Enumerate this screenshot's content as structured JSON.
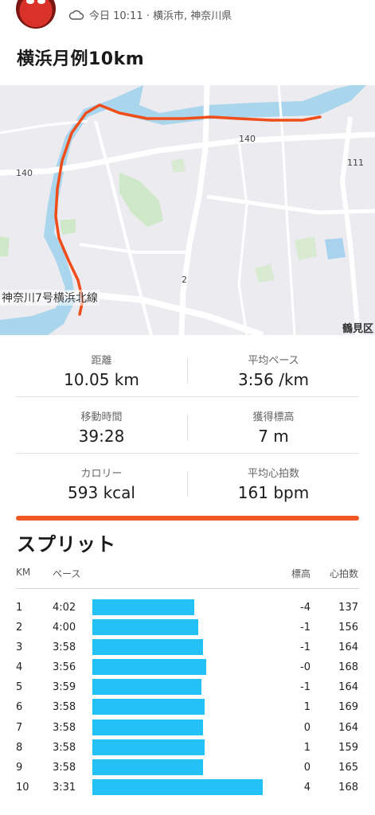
{
  "header": {
    "meta_text": "今日 10:11 · 横浜市, 神奈川県",
    "weather_icon": "cloud-icon"
  },
  "activity": {
    "title": "横浜月例10km"
  },
  "map": {
    "road_labels": [
      "140",
      "140",
      "111",
      "2"
    ],
    "highway_label": "神奈川7号横浜北線",
    "ward_label": "鶴見区",
    "route_color": "#ef4e1b"
  },
  "stats": {
    "distance": {
      "label": "距離",
      "value": "10.05 km"
    },
    "avg_pace": {
      "label": "平均ペース",
      "value": "3:56 /km"
    },
    "moving_time": {
      "label": "移動時間",
      "value": "39:28"
    },
    "elevation_gain": {
      "label": "獲得標高",
      "value": "7 m"
    },
    "calories": {
      "label": "カロリー",
      "value": "593 kcal"
    },
    "avg_hr": {
      "label": "平均心拍数",
      "value": "161 bpm"
    }
  },
  "splits": {
    "title": "スプリット",
    "headers": {
      "km": "KM",
      "pace": "ペース",
      "elevation": "標高",
      "heart_rate": "心拍数"
    },
    "bar_color": "#23c1f6",
    "accent_color": "#f05a22",
    "rows": [
      {
        "km": "1",
        "pace": "4:02",
        "speed": 0.6,
        "elevation": "-4",
        "heart_rate": "137"
      },
      {
        "km": "2",
        "pace": "4:00",
        "speed": 0.62,
        "elevation": "-1",
        "heart_rate": "156"
      },
      {
        "km": "3",
        "pace": "3:58",
        "speed": 0.65,
        "elevation": "-1",
        "heart_rate": "164"
      },
      {
        "km": "4",
        "pace": "3:56",
        "speed": 0.67,
        "elevation": "-0",
        "heart_rate": "168"
      },
      {
        "km": "5",
        "pace": "3:59",
        "speed": 0.64,
        "elevation": "-1",
        "heart_rate": "164"
      },
      {
        "km": "6",
        "pace": "3:58",
        "speed": 0.66,
        "elevation": "1",
        "heart_rate": "169"
      },
      {
        "km": "7",
        "pace": "3:58",
        "speed": 0.65,
        "elevation": "0",
        "heart_rate": "164"
      },
      {
        "km": "8",
        "pace": "3:58",
        "speed": 0.66,
        "elevation": "1",
        "heart_rate": "159"
      },
      {
        "km": "9",
        "pace": "3:58",
        "speed": 0.65,
        "elevation": "0",
        "heart_rate": "165"
      },
      {
        "km": "10",
        "pace": "3:31",
        "speed": 1.0,
        "elevation": "4",
        "heart_rate": "168"
      }
    ]
  }
}
